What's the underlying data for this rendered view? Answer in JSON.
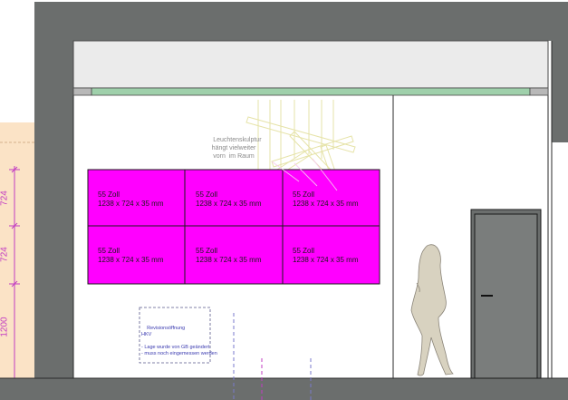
{
  "screens": [
    {
      "size": "55 Zoll",
      "dims": "1238 x 724 x 35 mm"
    },
    {
      "size": "55 Zoll",
      "dims": "1238 x 724 x 35 mm"
    },
    {
      "size": "55 Zoll",
      "dims": "1238 x 724 x 35 mm"
    },
    {
      "size": "55 Zoll",
      "dims": "1238 x 724 x 35 mm"
    },
    {
      "size": "55 Zoll",
      "dims": "1238 x 724 x 35 mm"
    },
    {
      "size": "55 Zoll",
      "dims": "1238 x 724 x 35 mm"
    }
  ],
  "sculpture_note": {
    "line1": "Leuchtenskulptur",
    "line2": "hängt vielweiter",
    "line3": "vorn  im Raum"
  },
  "revision_note": {
    "line1": "Revisionsöffnung",
    "line2": "HKV",
    "line3": "- Lage wurde von GB geändert",
    "line4": "- muss noch eingemessen werden"
  },
  "dimensions": {
    "d1": "724",
    "d2": "724",
    "d3": "1200"
  },
  "colors": {
    "wall": "#6b6e6d",
    "screen": "#ff00ff",
    "dimension": "#c23cc2",
    "ceiling_strip": "#9fd0ab",
    "floor_zone": "#fbe3c6"
  }
}
